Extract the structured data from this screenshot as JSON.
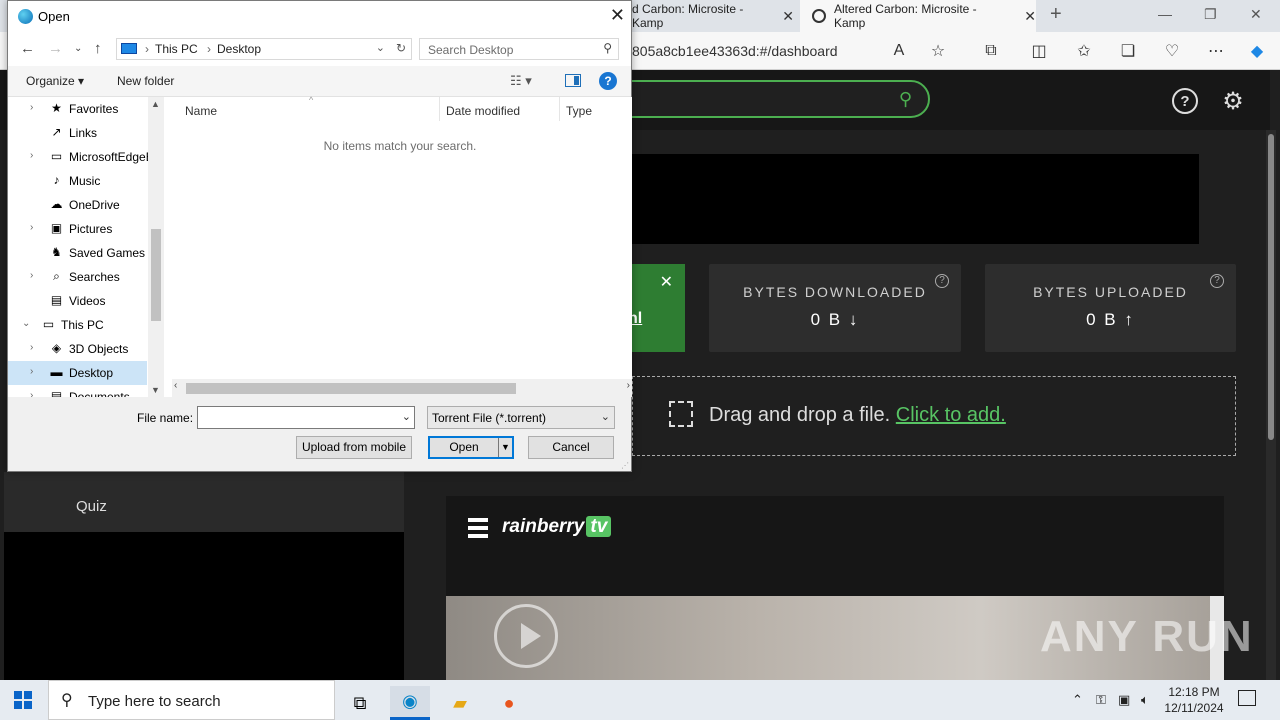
{
  "browser": {
    "tabs": [
      {
        "label": "d Carbon: Microsite - Kamp",
        "close": "✕"
      },
      {
        "label": "Altered Carbon: Microsite - Kamp",
        "close": "✕"
      }
    ],
    "new_tab": "+",
    "url": "805a8cb1ee43363d:#/dashboard",
    "window_controls": {
      "minimize": "—",
      "maximize": "❐",
      "close": "✕"
    }
  },
  "page": {
    "stats": [
      {
        "label": "BYTES DOWNLOADED",
        "value": "0 B ↓"
      },
      {
        "label": "BYTES UPLOADED",
        "value": "0 B ↑"
      }
    ],
    "green_card_fragment": "nl",
    "dropzone_text": "Drag and drop a file.",
    "dropzone_link": "Click to add.",
    "sidebar_item": "Quiz",
    "logo_text": "rainberry",
    "logo_tv": "tv",
    "watermark": "ANY RUN",
    "accent_color": "#4caf50"
  },
  "dialog": {
    "title": "Open",
    "breadcrumb": [
      "This PC",
      "Desktop"
    ],
    "search_placeholder": "Search Desktop",
    "organize_label": "Organize ▾",
    "new_folder_label": "New folder",
    "help_label": "?",
    "nav_items": [
      {
        "label": "Favorites",
        "icon": "★",
        "expand": "›",
        "selected": false,
        "indent": 1
      },
      {
        "label": "Links",
        "icon": "↗",
        "expand": "",
        "selected": false,
        "indent": 1
      },
      {
        "label": "MicrosoftEdgeBackups",
        "icon": "▭",
        "expand": "›",
        "selected": false,
        "indent": 1
      },
      {
        "label": "Music",
        "icon": "♪",
        "expand": "",
        "selected": false,
        "indent": 1
      },
      {
        "label": "OneDrive",
        "icon": "☁",
        "expand": "",
        "selected": false,
        "indent": 1
      },
      {
        "label": "Pictures",
        "icon": "▣",
        "expand": "›",
        "selected": false,
        "indent": 1
      },
      {
        "label": "Saved Games",
        "icon": "♞",
        "expand": "",
        "selected": false,
        "indent": 1
      },
      {
        "label": "Searches",
        "icon": "⌕",
        "expand": "›",
        "selected": false,
        "indent": 1
      },
      {
        "label": "Videos",
        "icon": "▤",
        "expand": "",
        "selected": false,
        "indent": 1
      },
      {
        "label": "This PC",
        "icon": "▭",
        "expand": "⌄",
        "selected": false,
        "indent": 0
      },
      {
        "label": "3D Objects",
        "icon": "◈",
        "expand": "›",
        "selected": false,
        "indent": 1
      },
      {
        "label": "Desktop",
        "icon": "▬",
        "expand": "›",
        "selected": true,
        "indent": 1
      },
      {
        "label": "Documents",
        "icon": "▤",
        "expand": "›",
        "selected": false,
        "indent": 1
      }
    ],
    "columns": [
      "Name",
      "Date modified",
      "Type"
    ],
    "empty_message": "No items match your search.",
    "file_name_label": "File name:",
    "file_name_value": "",
    "file_type_value": "Torrent File (*.torrent)",
    "upload_mobile_label": "Upload from mobile",
    "open_label": "Open",
    "cancel_label": "Cancel"
  },
  "taskbar": {
    "search_placeholder": "Type here to search",
    "time": "12:18 PM",
    "date": "12/11/2024"
  }
}
